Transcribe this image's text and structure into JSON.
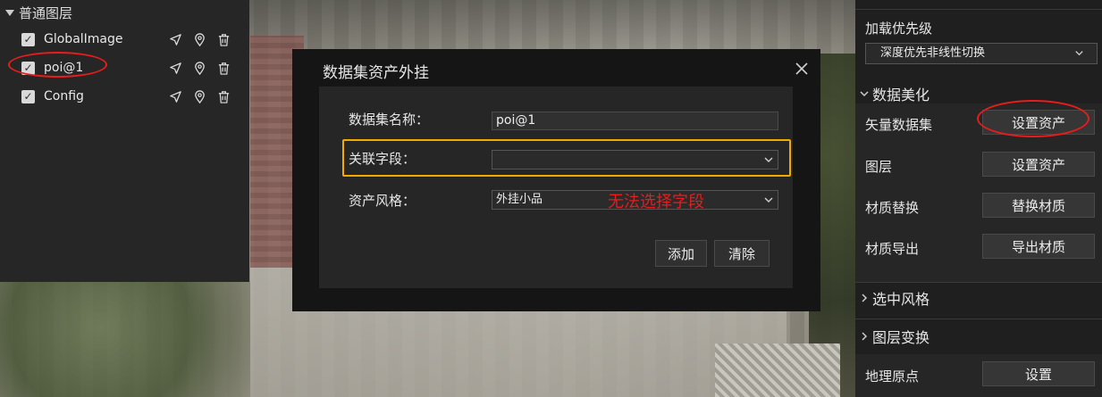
{
  "layers": {
    "header": "普通图层",
    "items": [
      {
        "name": "GlobalImage",
        "checked": true
      },
      {
        "name": "poi@1",
        "checked": true
      },
      {
        "name": "Config",
        "checked": true
      }
    ]
  },
  "dialog": {
    "title": "数据集资产外挂",
    "fields": {
      "dataset_name_label": "数据集名称：",
      "dataset_name_value": "poi@1",
      "link_field_label": "关联字段：",
      "link_field_value": "",
      "asset_style_label": "资产风格：",
      "asset_style_value": "外挂小品"
    },
    "annotation": "无法选择字段",
    "buttons": {
      "add": "添加",
      "clear": "清除"
    }
  },
  "right_panel": {
    "load_priority_label": "加载优先级",
    "load_priority_value": "深度优先非线性切换",
    "data_beautify_header": "数据美化",
    "rows": [
      {
        "label": "矢量数据集",
        "button": "设置资产"
      },
      {
        "label": "图层",
        "button": "设置资产"
      },
      {
        "label": "材质替换",
        "button": "替换材质"
      },
      {
        "label": "材质导出",
        "button": "导出材质"
      }
    ],
    "select_style_header": "选中风格",
    "layer_transform_header": "图层变换",
    "geo_origin_label": "地理原点",
    "geo_origin_button": "设置"
  },
  "colors": {
    "annotation_red": "#e81c1c",
    "highlight_orange": "#f2a900"
  },
  "icons": [
    "send-icon",
    "location-icon",
    "trash-icon",
    "close-icon",
    "chevron-down-icon",
    "chevron-right-icon"
  ]
}
